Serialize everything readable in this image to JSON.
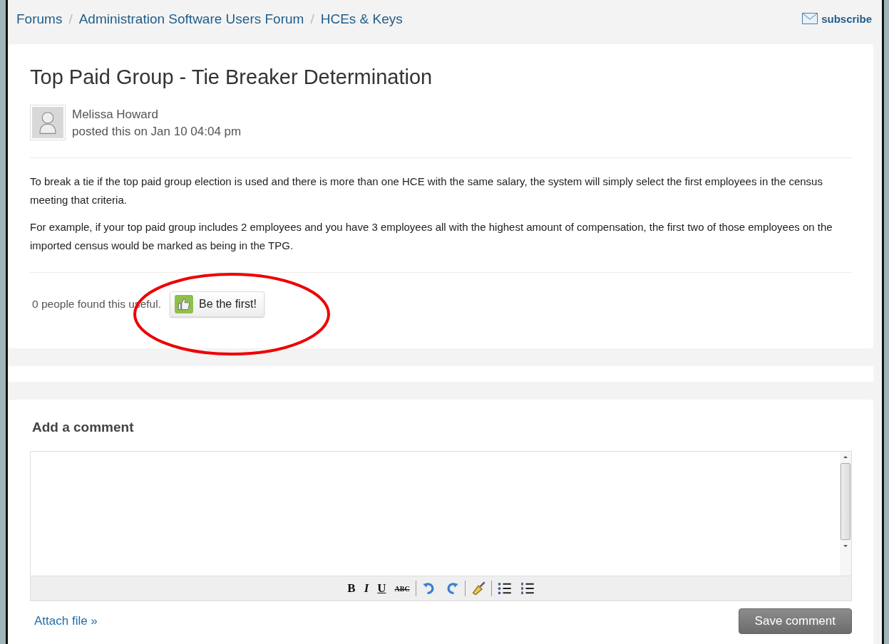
{
  "breadcrumbs": [
    {
      "label": "Forums"
    },
    {
      "label": "Administration Software Users Forum"
    },
    {
      "label": "HCEs & Keys"
    }
  ],
  "breadcrumb_separator": "/",
  "subscribe": {
    "label": "subscribe"
  },
  "post": {
    "title": "Top Paid Group - Tie Breaker Determination",
    "author": "Melissa Howard",
    "posted": "posted this on Jan 10 04:04 pm",
    "paragraphs": [
      "To break a tie if the top paid group election is used and there is more than one HCE with the same salary, the system will simply select the first employees in the census meeting that criteria.",
      "For example, if your top paid group includes 2 employees and you have 3 employees all with the highest amount of compensation, the first two of those employees on the imported census would be marked as being in the TPG."
    ],
    "useful_text": "0 people found this useful.",
    "vote_button": "Be the first!",
    "highlighted": true
  },
  "comment": {
    "heading": "Add a comment",
    "toolbar": [
      {
        "kind": "bold",
        "label": "B"
      },
      {
        "kind": "italic",
        "label": "I"
      },
      {
        "kind": "underline",
        "label": "U"
      },
      {
        "kind": "strike",
        "label": "ABC"
      },
      {
        "kind": "separator"
      },
      {
        "kind": "undo"
      },
      {
        "kind": "redo"
      },
      {
        "kind": "separator"
      },
      {
        "kind": "clean"
      },
      {
        "kind": "separator"
      },
      {
        "kind": "bullets"
      },
      {
        "kind": "numbers"
      }
    ],
    "attach": "Attach file »",
    "save": "Save comment"
  }
}
